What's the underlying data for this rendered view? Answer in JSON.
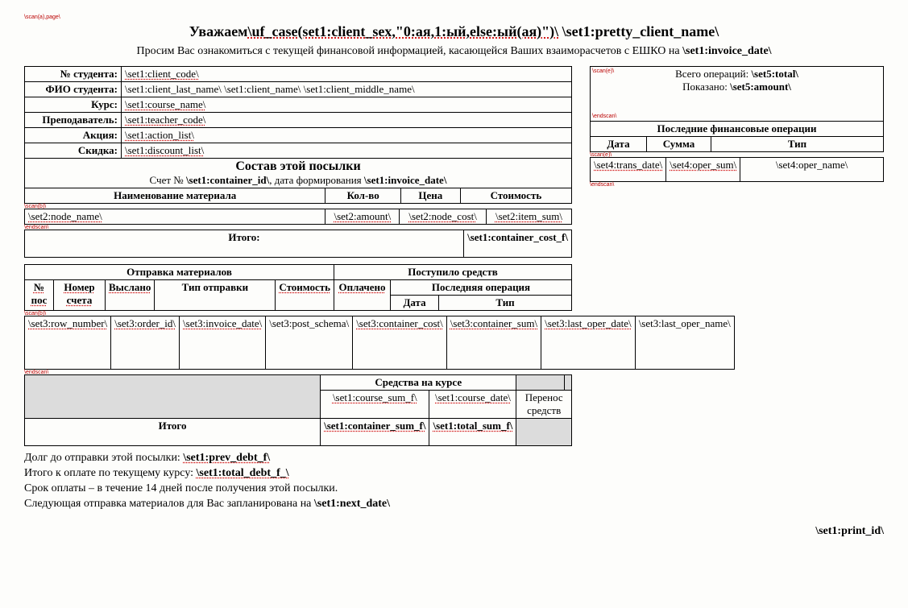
{
  "meta": {
    "scan_top": "\\scan(a),page\\",
    "scan_b": "\\scan(b)\\",
    "endscan": "\\endscan\\",
    "scan_e": "\\scan(e)\\"
  },
  "title": {
    "prefix": "Уважаем",
    "uf": "\\uf_case(set1:client_sex,\"0:ая,1:ый,else:ый(ая)\")\\",
    "name": "\\set1:pretty_client_name\\"
  },
  "intro": {
    "text": "Просим Вас ознакомиться с текущей финансовой информацией, касающейся Ваших взаиморасчетов с ЕШКО на ",
    "date": "\\set1:invoice_date\\"
  },
  "student_rows": [
    {
      "label": "№ студента:",
      "value": "\\set1:client_code\\",
      "dotted": true
    },
    {
      "label": "ФИО студента:",
      "value": "\\set1:client_last_name\\ \\set1:client_name\\ \\set1:client_middle_name\\",
      "dotted": false
    },
    {
      "label": "Курс:",
      "value": "\\set1:course_name\\",
      "dotted": true
    },
    {
      "label": "Преподаватель:",
      "value": "\\set1:teacher_code\\",
      "dotted": true
    },
    {
      "label": "Акция:",
      "value": "\\set1:action_list\\",
      "dotted": true
    },
    {
      "label": "Скидка:",
      "value": "\\set1:discount_list\\",
      "dotted": true
    }
  ],
  "parcel": {
    "heading": "Состав этой посылки",
    "sub_prefix": "Счет № ",
    "container_id": "\\set1:container_id\\",
    "sub_mid": ", дата формирования ",
    "inv_date": "\\set1:invoice_date\\",
    "cols": {
      "name": "Наименование материала",
      "qty": "Кол-во",
      "price": "Цена",
      "cost": "Стоимость"
    },
    "row": {
      "name": "\\set2:node_name\\",
      "qty": "\\set2:amount\\",
      "price": "\\set2:node_cost\\",
      "cost": "\\set2:item_sum\\"
    },
    "total_label": "Итого:",
    "total_value": "\\set1:container_cost_f\\"
  },
  "ops_box": {
    "total_label": "Всего операций: ",
    "total_value": "\\set5:total\\",
    "shown_label": "Показано: ",
    "shown_value": "\\set5:amount\\",
    "heading": "Последние финансовые операции",
    "cols": {
      "date": "Дата",
      "sum": "Сумма",
      "type": "Тип"
    },
    "row": {
      "date": "\\set4:trans_date\\",
      "sum": "\\set4:oper_sum\\",
      "type": "\\set4:oper_name\\"
    }
  },
  "ship": {
    "left_heading": "Отправка материалов",
    "right_heading": "Поступило средств",
    "cols": {
      "no": "№ пос",
      "order": "Номер счета",
      "sent": "Выслано",
      "ship_type": "Тип отправки",
      "cost": "Стоимость",
      "paid": "Оплачено",
      "last_op": "Последняя операция",
      "date": "Дата",
      "type": "Тип"
    },
    "row": {
      "no": "\\set3:row_number\\",
      "order": "\\set3:order_id\\",
      "sent": "\\set3:invoice_date\\",
      "ship_type": "\\set3:post_schema\\",
      "cost": "\\set3:container_cost\\",
      "paid": "\\set3:container_sum\\",
      "date": "\\set3:last_oper_date\\",
      "type": "\\set3:last_oper_name\\"
    },
    "funds_heading": "Средства на курсе",
    "funds_row": {
      "sum": "\\set1:course_sum_f\\",
      "date": "\\set1:course_date\\",
      "type": "Перенос средств"
    },
    "total_label": "Итого",
    "total_cost": "\\set1:container_sum_f\\",
    "total_paid": "\\set1:total_sum_f\\"
  },
  "footer": {
    "l1a": "Долг до отправки этой посылки: ",
    "l1b": "\\set1:prev_debt_f\\",
    "l2a": "Итого к оплате по текущему курсу: ",
    "l2b": "\\set1:total_debt_f_\\",
    "l3": "Срок оплаты – в течение 14 дней после получения этой посылки.",
    "l4a": "Следующая отправка материалов для Вас запланирована на ",
    "l4b": "\\set1:next_date\\",
    "print_id": "\\set1:print_id\\"
  }
}
